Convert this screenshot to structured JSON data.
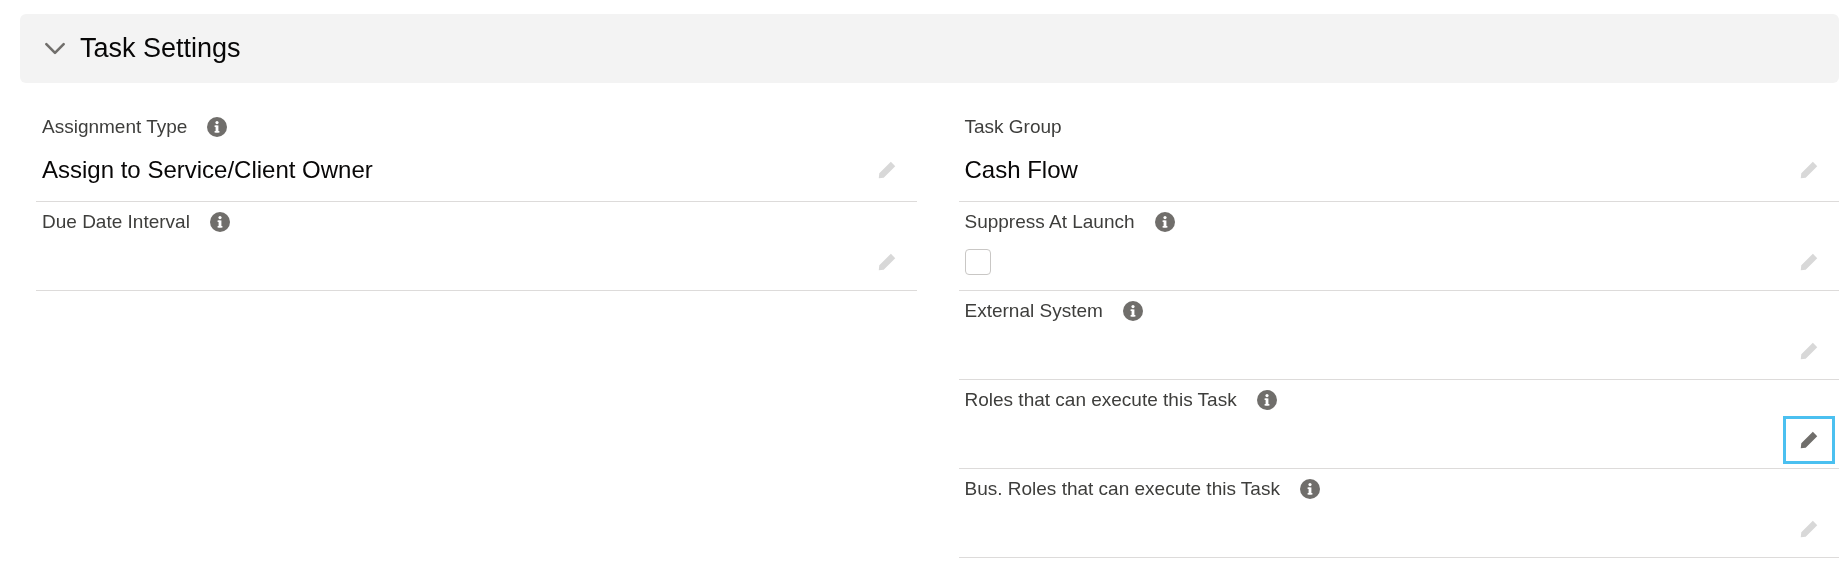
{
  "section": {
    "title": "Task Settings",
    "expanded": true
  },
  "columns": [
    {
      "fields": [
        {
          "kind": "text",
          "label": "Assignment Type",
          "info": true,
          "value": "Assign to Service/Client Owner",
          "edit_focused": false
        },
        {
          "kind": "text",
          "label": "Due Date Interval",
          "info": true,
          "edit_focused": false
        }
      ]
    },
    {
      "fields": [
        {
          "kind": "text",
          "label": "Task Group",
          "info": false,
          "value": "Cash Flow",
          "edit_focused": false
        },
        {
          "kind": "checkbox",
          "label": "Suppress At Launch",
          "info": true,
          "checked": false,
          "edit_focused": false
        },
        {
          "kind": "text",
          "label": "External System",
          "info": true,
          "edit_focused": false
        },
        {
          "kind": "text",
          "label": "Roles that can execute this Task",
          "info": true,
          "edit_focused": true
        },
        {
          "kind": "text",
          "label": "Bus. Roles that can execute this Task",
          "info": true,
          "edit_focused": false
        }
      ]
    }
  ]
}
